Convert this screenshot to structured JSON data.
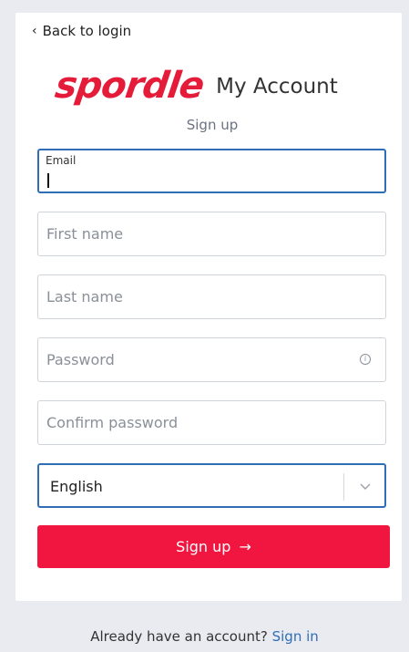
{
  "back_link": {
    "icon": "chevron-left-icon",
    "label": "Back to login"
  },
  "brand": {
    "logo_text": "spordle",
    "suffix": "My Account",
    "logo_color": "#e51b3a"
  },
  "form": {
    "title": "Sign up",
    "email": {
      "label": "Email",
      "value": ""
    },
    "first_name": {
      "placeholder": "First name"
    },
    "last_name": {
      "placeholder": "Last name"
    },
    "password": {
      "placeholder": "Password",
      "icon": "info-icon"
    },
    "confirm_password": {
      "placeholder": "Confirm password"
    },
    "language": {
      "selected": "English",
      "icon": "chevron-down-icon"
    },
    "submit": {
      "label": "Sign up",
      "icon": "arrow-right-icon",
      "color": "#f0163f"
    }
  },
  "footer": {
    "text": "Already have an account?",
    "link": "Sign in",
    "link_color": "#2f6db5"
  }
}
